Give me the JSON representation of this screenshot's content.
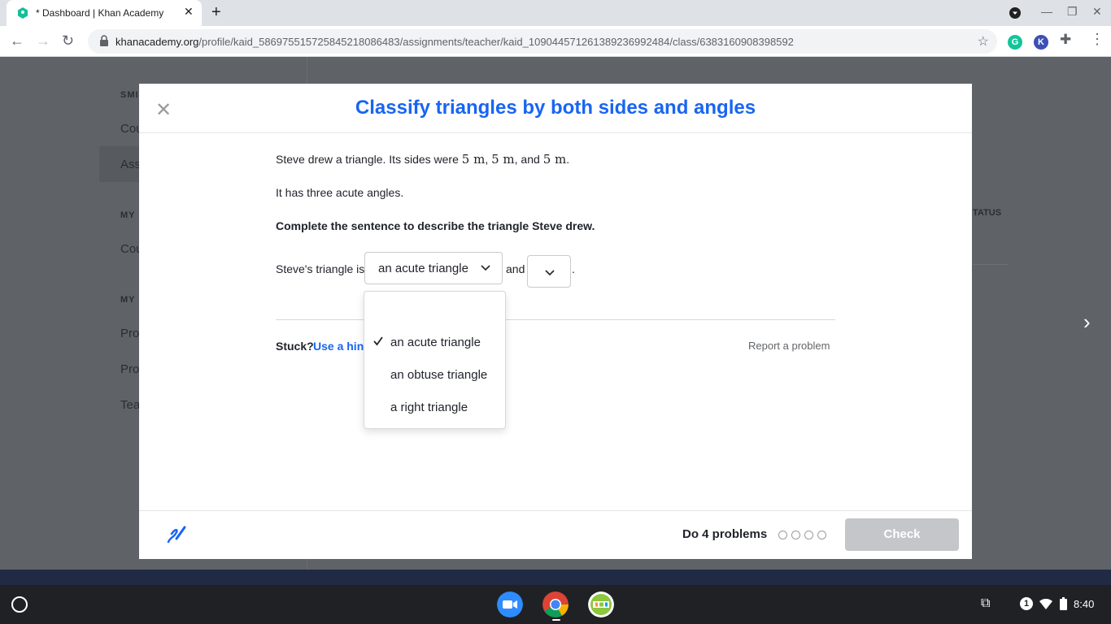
{
  "browser": {
    "tab_title": "* Dashboard | Khan Academy",
    "url_host": "khanacademy.org",
    "url_path": "/profile/kaid_586975515725845218086483/assignments/teacher/kaid_1090445712613892369924​84/class/6383160908398592",
    "ext_k_label": "K"
  },
  "background_page": {
    "sidebar_heading_1": "SMI",
    "sidebar_item_1": "Cou",
    "sidebar_item_2": "Ass",
    "sidebar_heading_2": "MY",
    "sidebar_item_3": "Cou",
    "sidebar_heading_3": "MY",
    "sidebar_item_4": "Pro",
    "sidebar_item_5": "Pro",
    "sidebar_item_6": "Tea",
    "status_col": "TATUS"
  },
  "modal": {
    "title": "Classify triangles by both sides and angles",
    "q_line1_prefix": "Steve drew a triangle. Its sides were ",
    "side_a": "5 m",
    "sep1": ", ",
    "side_b": "5 m",
    "sep2": ", and ",
    "side_c": "5 m",
    "end": ".",
    "q_line2": "It has three acute angles.",
    "instruction": "Complete the sentence to describe the triangle Steve drew.",
    "sentence_prefix": "Steve's triangle is",
    "select1_value": "an acute triangle",
    "sentence_mid": "and",
    "sentence_end": ".",
    "dropdown_options": [
      "an acute triangle",
      "an obtuse triangle",
      "a right triangle"
    ],
    "stuck_label": "Stuck?",
    "hint_link": "Use a hint",
    "report_link": "Report a problem",
    "progress_label": "Do 4 problems",
    "check_button": "Check"
  },
  "shelf": {
    "notification_count": "1",
    "time": "8:40"
  },
  "colors": {
    "brand_blue": "#1865f2",
    "disabled_button": "#c5c6c9"
  }
}
